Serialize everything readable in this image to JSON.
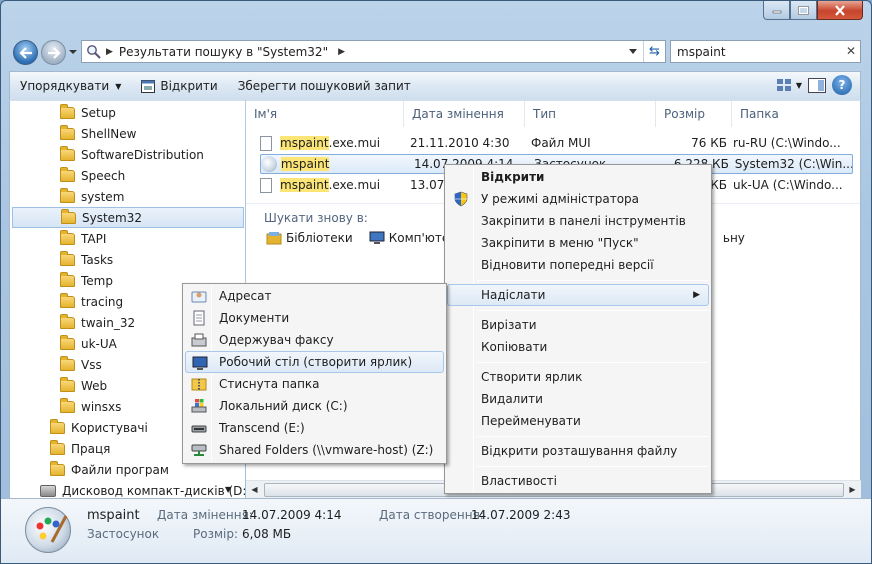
{
  "window": {
    "address_crumb": "Результати пошуку в \"System32\"",
    "search_value": "mspaint"
  },
  "toolbar": {
    "organize": "Упорядкувати",
    "open": "Відкрити",
    "save_search": "Зберегти пошуковий запит"
  },
  "tree": {
    "items": [
      {
        "label": "Setup"
      },
      {
        "label": "ShellNew"
      },
      {
        "label": "SoftwareDistribution"
      },
      {
        "label": "Speech"
      },
      {
        "label": "system"
      },
      {
        "label": "System32"
      },
      {
        "label": "TAPI"
      },
      {
        "label": "Tasks"
      },
      {
        "label": "Temp"
      },
      {
        "label": "tracing"
      },
      {
        "label": "twain_32"
      },
      {
        "label": "uk-UA"
      },
      {
        "label": "Vss"
      },
      {
        "label": "Web"
      },
      {
        "label": "winsxs"
      },
      {
        "label": "Користувачі"
      },
      {
        "label": "Праця"
      },
      {
        "label": "Файли програм"
      },
      {
        "label": "Дисковод компакт-дисків (D:)"
      }
    ]
  },
  "columns": [
    "Ім'я",
    "Дата змінення",
    "Тип",
    "Розмір",
    "Папка"
  ],
  "files": [
    {
      "name_hl": "mspaint",
      "name_rest": ".exe.mui",
      "date": "21.11.2010 4:30",
      "type": "Файл MUI",
      "size": "76 КБ",
      "folder": "ru-RU (C:\\Windo..."
    },
    {
      "name_hl": "mspaint",
      "name_rest": "",
      "date": "14.07.2009 4:14",
      "type": "Застосунок",
      "size": "6 228 КБ",
      "folder": "System32 (C:\\Win..."
    },
    {
      "name_hl": "mspaint",
      "name_rest": ".exe.mui",
      "date": "13.07.",
      "type": "",
      "size": "КБ",
      "folder": "uk-UA (C:\\Windo..."
    }
  ],
  "search_again": {
    "title": "Шукати знову в:",
    "libraries": "Бібліотеки",
    "computer": "Комп'ютер",
    "more": "ьну"
  },
  "context_menu": {
    "items": [
      {
        "label": "Відкрити"
      },
      {
        "label": "У режимі адміністратора"
      },
      {
        "label": "Закріпити в панелі інструментів"
      },
      {
        "label": "Закріпити в меню \"Пуск\""
      },
      {
        "label": "Відновити попередні версії"
      },
      {
        "label": "Надіслати"
      },
      {
        "label": "Вирізати"
      },
      {
        "label": "Копіювати"
      },
      {
        "label": "Створити ярлик"
      },
      {
        "label": "Видалити"
      },
      {
        "label": "Перейменувати"
      },
      {
        "label": "Відкрити розташування файлу"
      },
      {
        "label": "Властивості"
      }
    ]
  },
  "send_to_menu": {
    "items": [
      {
        "label": "Адресат"
      },
      {
        "label": "Документи"
      },
      {
        "label": "Одержувач факсу"
      },
      {
        "label": "Робочий стіл (створити ярлик)"
      },
      {
        "label": "Стиснута папка"
      },
      {
        "label": "Локальний диск (C:)"
      },
      {
        "label": "Transcend (E:)"
      },
      {
        "label": "Shared Folders (\\\\vmware-host) (Z:)"
      }
    ]
  },
  "details": {
    "name": "mspaint",
    "type": "Застосунок",
    "modified_label": "Дата змінення:",
    "modified_value": "14.07.2009 4:14",
    "created_label": "Дата створення:",
    "created_value": "14.07.2009 2:43",
    "size_label": "Розмір:",
    "size_value": "6,08 МБ"
  }
}
